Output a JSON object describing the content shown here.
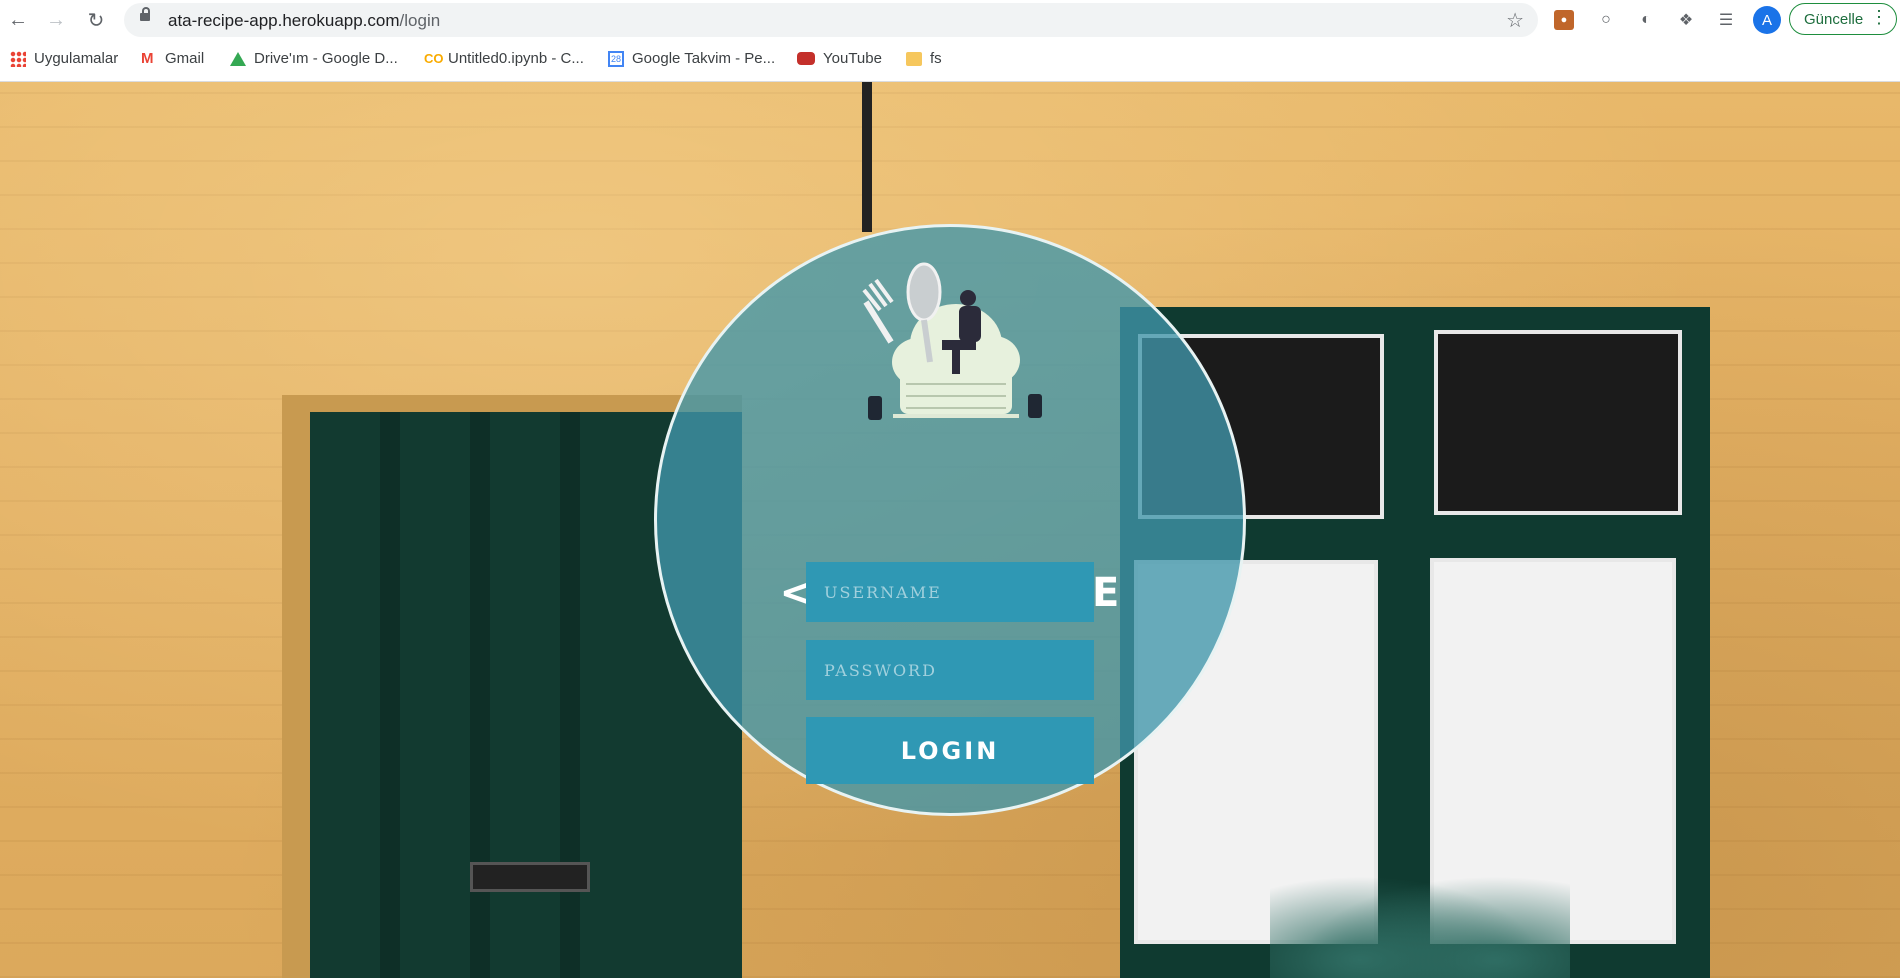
{
  "browser": {
    "url_host": "ata-recipe-app.herokuapp.com",
    "url_path": "/login",
    "profile_initial": "A",
    "update_label": "Güncelle",
    "icons": [
      "back-arrow-icon",
      "forward-arrow-icon",
      "reload-icon",
      "lock-icon",
      "bookmark-star-icon",
      "extension-icon",
      "puzzle-icon",
      "reading-list-icon",
      "more-menu-icon"
    ]
  },
  "bookmarks": [
    {
      "label": "Uygulamalar",
      "icon": "apps-grid-icon"
    },
    {
      "label": "Gmail",
      "icon": "gmail-icon"
    },
    {
      "label": "Drive'ım - Google D...",
      "icon": "google-drive-icon"
    },
    {
      "label": "Untitled0.ipynb - C...",
      "icon": "colab-icon"
    },
    {
      "label": "Google Takvim - Pe...",
      "icon": "google-calendar-icon"
    },
    {
      "label": "YouTube",
      "icon": "youtube-icon"
    },
    {
      "label": "fs",
      "icon": "folder-icon"
    }
  ],
  "login": {
    "brand": "<ata/> RECIPE",
    "username_placeholder": "USERNAME",
    "password_placeholder": "PASSWORD",
    "login_label": "LOGIN"
  },
  "colors": {
    "circle_overlay": "#4096aa",
    "field_bg": "#2f98b4",
    "wall": "#e3b063",
    "door": "#123a30"
  }
}
